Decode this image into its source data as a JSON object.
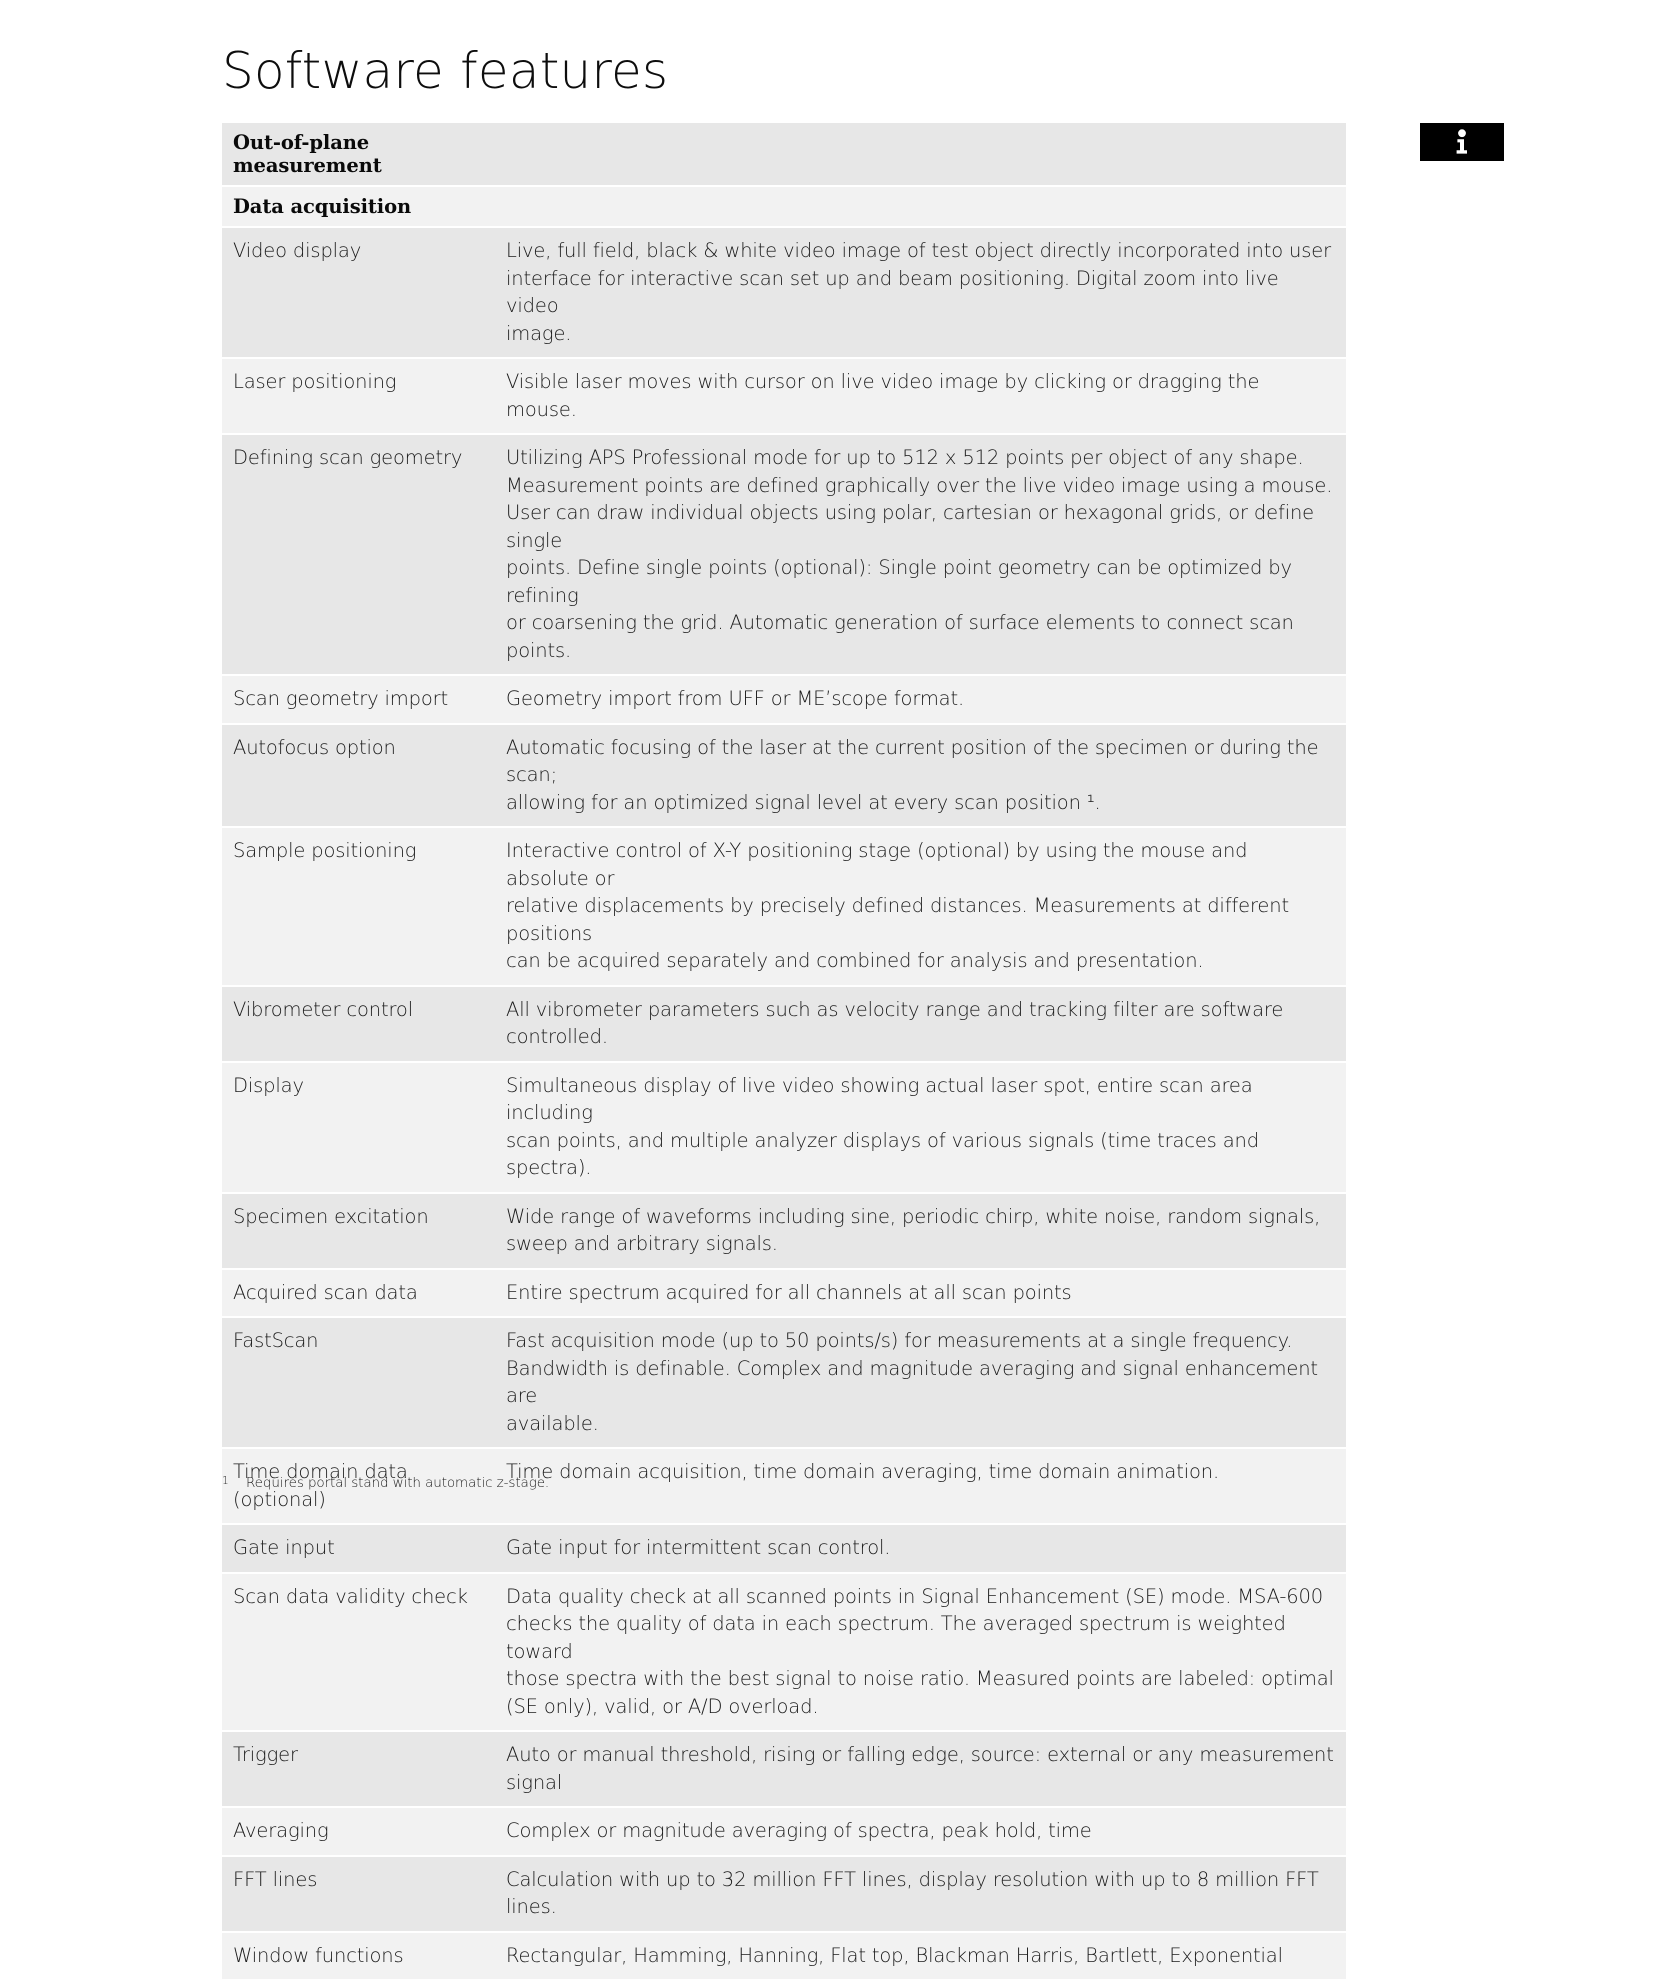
{
  "page": {
    "title": "Software features"
  },
  "badge": {
    "icon": "info-icon",
    "background_color": "#000000",
    "glyph_color": "#ffffff"
  },
  "table": {
    "colors": {
      "row_dark": "#e7e7e7",
      "row_light": "#f2f2f2",
      "separator": "#ffffff",
      "text": "#1b1b1b",
      "header_text": "#0a0a0a"
    },
    "rows": [
      {
        "type": "header",
        "shade": "dark",
        "label": "Out-of-plane measurement",
        "description": ""
      },
      {
        "type": "header",
        "shade": "light",
        "label": "Data acquisition",
        "description": ""
      },
      {
        "type": "item",
        "shade": "dark",
        "label": "Video display",
        "description": "Live, full field, black & white video image of test object directly incorporated into user\ninterface for interactive scan set up and beam positioning. Digital zoom into live video\nimage."
      },
      {
        "type": "item",
        "shade": "light",
        "label": "Laser positioning",
        "description": "Visible laser moves with cursor on live video image by clicking or dragging the mouse."
      },
      {
        "type": "item",
        "shade": "dark",
        "label": "Defining scan geometry",
        "description": "Utilizing APS Professional mode for up to 512 x 512 points per object of any shape.\nMeasurement points are defined graphically over the live video image using a mouse.\nUser can draw individual objects using polar, cartesian or hexagonal grids, or define single\npoints. Define single points (optional): Single point geometry can be optimized by refining\nor coarsening the grid. Automatic generation of surface elements to connect scan points."
      },
      {
        "type": "item",
        "shade": "light",
        "label": "Scan geometry import",
        "description": "Geometry import from UFF or ME’scope format."
      },
      {
        "type": "item",
        "shade": "dark",
        "label": "Autofocus option",
        "description": "Automatic focusing of the laser at the current position of the specimen or during the scan;\nallowing for an optimized signal level at every scan position ¹."
      },
      {
        "type": "item",
        "shade": "light",
        "label": "Sample positioning",
        "description": "Interactive control of X-Y positioning stage (optional) by using the mouse and absolute or\nrelative displacements by precisely defined distances. Measurements at different positions\ncan be acquired separately and combined for analysis and presentation."
      },
      {
        "type": "item",
        "shade": "dark",
        "label": "Vibrometer control",
        "description": "All vibrometer parameters such as velocity range and tracking filter are software controlled."
      },
      {
        "type": "item",
        "shade": "light",
        "label": "Display",
        "description": "Simultaneous display of live video showing actual laser spot, entire scan area including\nscan points, and multiple analyzer displays of various signals (time traces and spectra)."
      },
      {
        "type": "item",
        "shade": "dark",
        "label": "Specimen excitation",
        "description": "Wide range of waveforms including sine, periodic chirp, white noise, random signals,\nsweep and arbitrary signals."
      },
      {
        "type": "item",
        "shade": "light",
        "label": "Acquired scan data",
        "description": "Entire spectrum acquired for all channels at all scan points"
      },
      {
        "type": "item",
        "shade": "dark",
        "label": "FastScan",
        "description": "Fast acquisition mode (up to 50 points/s) for measurements at a single frequency.\nBandwidth is definable. Complex and magnitude averaging and signal enhancement are\navailable."
      },
      {
        "type": "item",
        "shade": "light",
        "label": "Time domain data (optional)",
        "description": "Time domain acquisition, time domain averaging, time domain animation."
      },
      {
        "type": "item",
        "shade": "dark",
        "label": "Gate input",
        "description": "Gate input for intermittent scan control."
      },
      {
        "type": "item",
        "shade": "light",
        "label": "Scan data validity check",
        "description": "Data quality check at all scanned points in Signal Enhancement (SE) mode. MSA-600\nchecks the quality of data in each spectrum. The averaged spectrum is weighted toward\nthose spectra with the best signal to noise ratio. Measured points are labeled: optimal\n(SE only), valid, or A/D overload."
      },
      {
        "type": "item",
        "shade": "dark",
        "label": "Trigger",
        "description": "Auto or manual threshold, rising or falling edge, source: external or any measurement signal"
      },
      {
        "type": "item",
        "shade": "light",
        "label": "Averaging",
        "description": "Complex or magnitude averaging of spectra, peak hold, time"
      },
      {
        "type": "item",
        "shade": "dark",
        "label": "FFT lines",
        "description": "Calculation with up to 32 million FFT lines, display resolution with up to 8 million FFT lines."
      },
      {
        "type": "item",
        "shade": "light",
        "label": "Window functions",
        "description": "Rectangular, Hamming, Hanning, Flat top, Blackman Harris, Bartlett, Exponential"
      }
    ]
  },
  "footnote": {
    "marker": "1",
    "text": "Requires portal stand with automatic z-stage."
  }
}
